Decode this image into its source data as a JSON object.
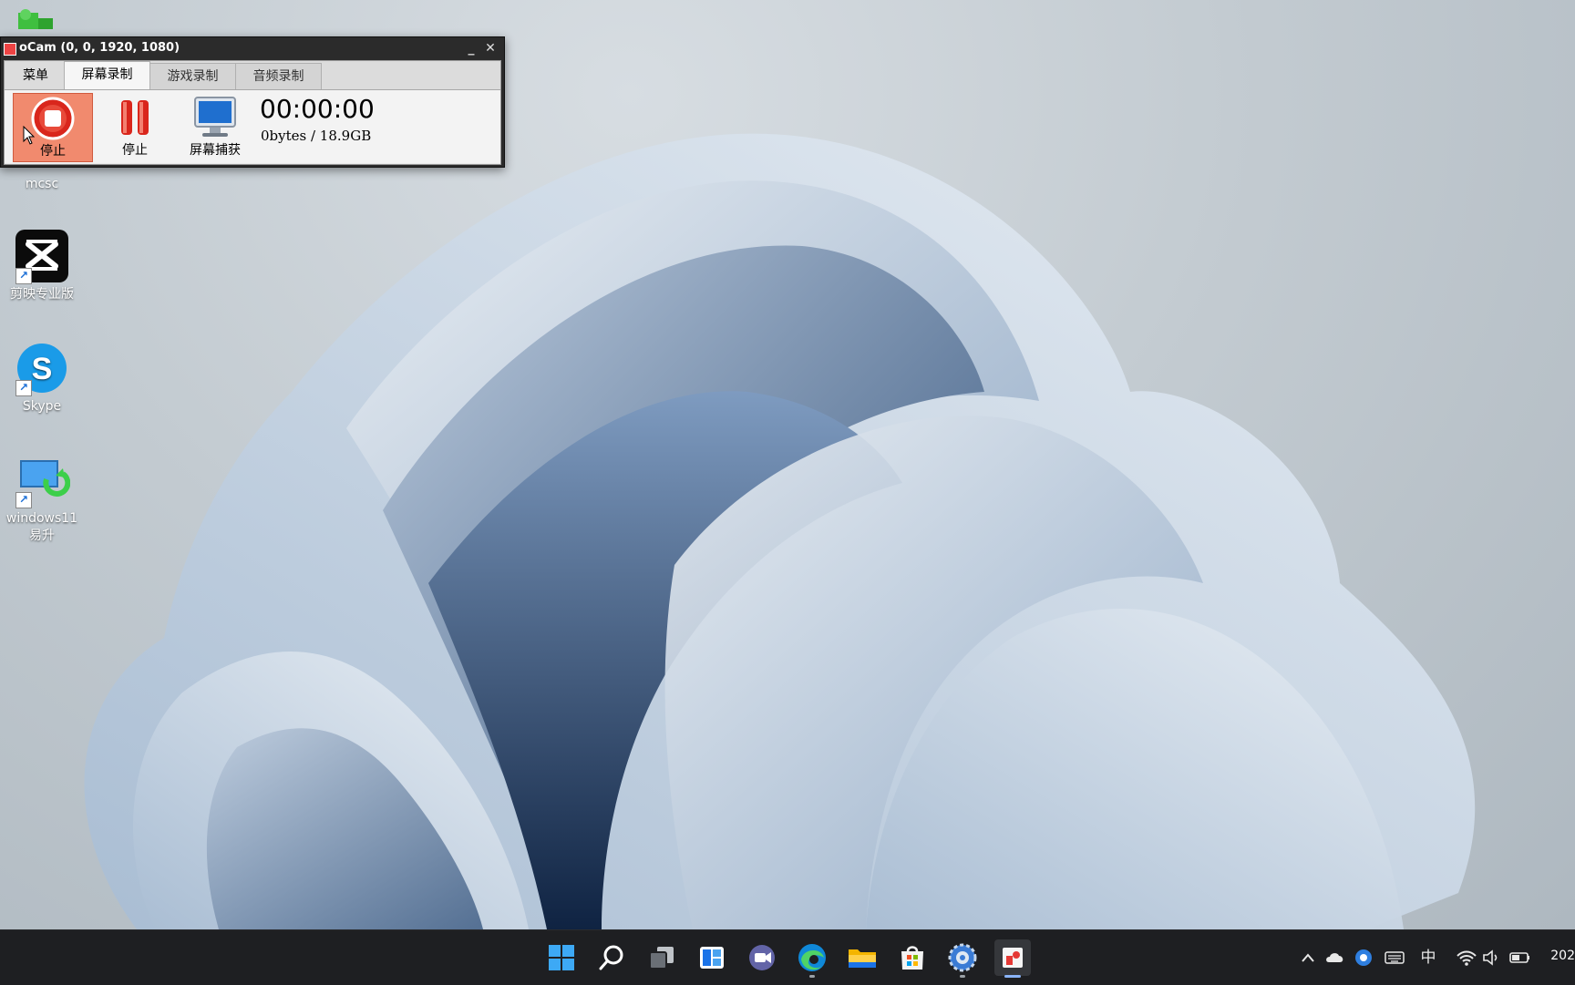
{
  "desktop": {
    "icons": [
      {
        "label": "mcsc"
      },
      {
        "label": "剪映专业版"
      },
      {
        "label": "Skype"
      },
      {
        "label": "windows11\n易升"
      }
    ]
  },
  "ocam": {
    "title": "oCam (0, 0, 1920, 1080)",
    "minimize": "_",
    "close": "✕",
    "tabs": [
      "菜单",
      "屏幕录制",
      "游戏录制",
      "音频录制"
    ],
    "active_tab": "屏幕录制",
    "buttons": {
      "stop": "停止",
      "pause": "停止",
      "capture": "屏幕捕获"
    },
    "timer": "00:00:00",
    "size": "0bytes / 18.9GB"
  },
  "taskbar": {
    "pinned": [
      "start-icon",
      "search-icon",
      "task-view-icon",
      "widgets-icon",
      "chat-icon",
      "edge-icon",
      "file-explorer-icon",
      "store-icon",
      "settings-icon",
      "ocam-icon"
    ],
    "tray": {
      "ime": "中",
      "clock_partial": "202"
    }
  },
  "colors": {
    "taskbar_bg": "#1e1f22",
    "ocam_stop_hover": "#f18a6e",
    "accent": "#0078d4"
  }
}
